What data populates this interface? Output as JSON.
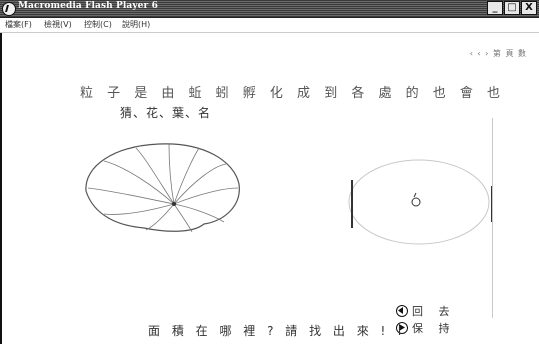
{
  "window": {
    "title": "Macromedia Flash Player 6",
    "min_label": "_",
    "max_label": "□",
    "close_label": "X"
  },
  "menu": [
    {
      "label": "檔案(F)"
    },
    {
      "label": "檢視(V)"
    },
    {
      "label": "控制(C)"
    },
    {
      "label": "說明(H)"
    }
  ],
  "page_nav": "‹ ‹ ›  第 頁 數",
  "riddle": {
    "line1": "粒 子 是 由 蚯 蚓 孵 化 成 到 各 處 的 也 會 也",
    "line2": "猜、花、葉、名"
  },
  "instruction": "面 積 在 哪 裡 ? 請 找 出 來 ! !",
  "controls": {
    "back_label": "回 去",
    "hold_label": "保 持"
  }
}
